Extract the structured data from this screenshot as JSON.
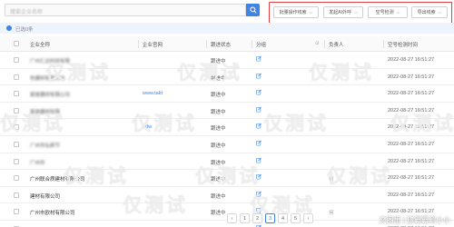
{
  "search": {
    "placeholder": "搜索企业名称"
  },
  "actions": [
    {
      "label": "批量操作线索"
    },
    {
      "label": "发起AI外呼"
    },
    {
      "label": "空号检测"
    },
    {
      "label": "导出线索"
    }
  ],
  "selection": {
    "text": "已选0条"
  },
  "table": {
    "headers": [
      "企业全称",
      "企业官网",
      "跟进状态",
      "分组",
      "负责人",
      "空号检测时间"
    ],
    "rows": [
      {
        "company": "广州汇达科技有限",
        "website": "",
        "status": "跟进中",
        "owner": "",
        "time": "2022-08-27 16:51:27"
      },
      {
        "company": "色建材有限公司",
        "website": "",
        "status": "跟进中",
        "owner": "",
        "time": "2022-08-27 16:51:27"
      },
      {
        "company": "家居建材有限公司",
        "website": "www.takt",
        "status": "跟进中",
        "owner": "",
        "time": "2022-08-27 16:51:27"
      },
      {
        "company": "家居建材有限",
        "website": "",
        "status": "跟进中",
        "owner": "",
        "time": "2022-08-27 16:51:27"
      },
      {
        "company": "",
        "website": "odw",
        "status": "跟进中",
        "owner": "",
        "time": "2022-08-27 16:51:27"
      },
      {
        "company": "广州市弘昇节",
        "website": "",
        "status": "跟进中",
        "owner": "",
        "time": "2022-08-27 16:51:27"
      },
      {
        "company": "广州市",
        "website": "",
        "status": "跟进中",
        "owner": "",
        "time": "2022-08-27 16:51:27"
      },
      {
        "company": "广州联合质建材有限公司",
        "website": "",
        "status": "跟进中",
        "owner": "何",
        "time": "2022-08-27 16:51:27"
      },
      {
        "company": "建材有限公司",
        "website": "",
        "status": "跟进中",
        "owner": "",
        "time": "2022-08-27 16:51:27"
      },
      {
        "company": "广州市欧材有限公司",
        "website": "",
        "status": "跟进中",
        "owner": "何",
        "time": "2022-08-27 16:51:27"
      },
      {
        "company": "广州卓胜建材有限公司",
        "website": "",
        "status": "跟进中",
        "owner": "",
        "time": "2022-08-27 16:51:27"
      }
    ]
  },
  "pagination": {
    "pages": [
      "1",
      "2",
      "3",
      "4",
      "5"
    ],
    "current": "3"
  },
  "watermark": "仅测试",
  "caption": "文图里 | 旅霸霸测小小",
  "colors": {
    "accent": "#3f84e5",
    "highlight_border": "#e04040"
  },
  "icons": {
    "search": "search-icon",
    "edit": "edit-icon",
    "chevron": "chevron-down-icon",
    "settings": "settings-icon"
  }
}
